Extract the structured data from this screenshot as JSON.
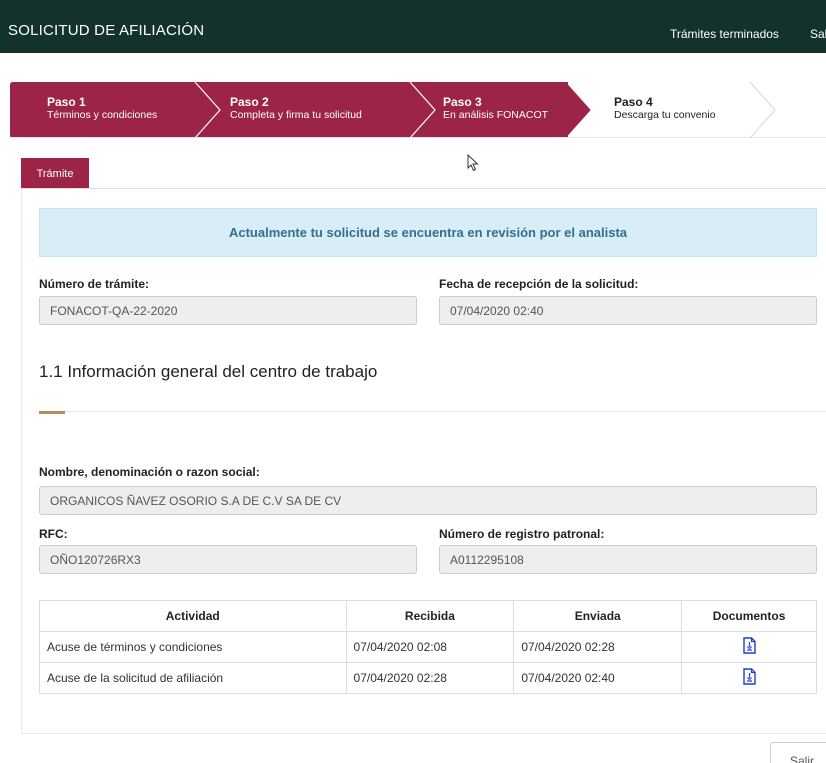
{
  "header": {
    "title": "SOLICITUD DE AFILIACIÓN",
    "nav": [
      "Trámites terminados",
      "Sal"
    ]
  },
  "stepper": [
    {
      "number": "Paso 1",
      "label": "Términos y condiciones",
      "state": "done"
    },
    {
      "number": "Paso 2",
      "label": "Completa y firma tu solicitud",
      "state": "done"
    },
    {
      "number": "Paso 3",
      "label": "En análisis FONACOT",
      "state": "current"
    },
    {
      "number": "Paso 4",
      "label": "Descarga tu convenio",
      "state": "pending"
    }
  ],
  "tab": "Trámite",
  "alert": "Actualmente tu solicitud se encuentra en revisión por el analista",
  "tramite": {
    "numero_label": "Número de trámite:",
    "numero_value": "FONACOT-QA-22-2020",
    "fecha_label": "Fecha de recepción de la solicitud:",
    "fecha_value": "07/04/2020 02:40"
  },
  "section": {
    "title": "1.1 Información general del centro de trabajo"
  },
  "centro": {
    "nombre_label": "Nombre, denominación o razon social:",
    "nombre_value": "ORGANICOS ÑAVEZ OSORIO S.A DE C.V SA DE CV",
    "rfc_label": "RFC:",
    "rfc_value": "OÑO120726RX3",
    "registro_label": "Número de registro patronal:",
    "registro_value": "A0112295108"
  },
  "table": {
    "headers": [
      "Actividad",
      "Recibida",
      "Enviada",
      "Documentos"
    ],
    "rows": [
      {
        "actividad": "Acuse de términos y condiciones",
        "recibida": "07/04/2020 02:08",
        "enviada": "07/04/2020 02:28",
        "doc_icon": "pdf-document-icon"
      },
      {
        "actividad": "Acuse de la solicitud de afiliación",
        "recibida": "07/04/2020 02:28",
        "enviada": "07/04/2020 02:40",
        "doc_icon": "pdf-document-icon"
      }
    ]
  },
  "buttons": {
    "salir": "Salir"
  },
  "colors": {
    "header_bg": "#13322b",
    "brand": "#9d2449",
    "gold_accent": "#b38e5d",
    "alert_bg": "#d9edf7",
    "alert_text": "#31708f",
    "icon_blue": "#1f3fcf"
  }
}
